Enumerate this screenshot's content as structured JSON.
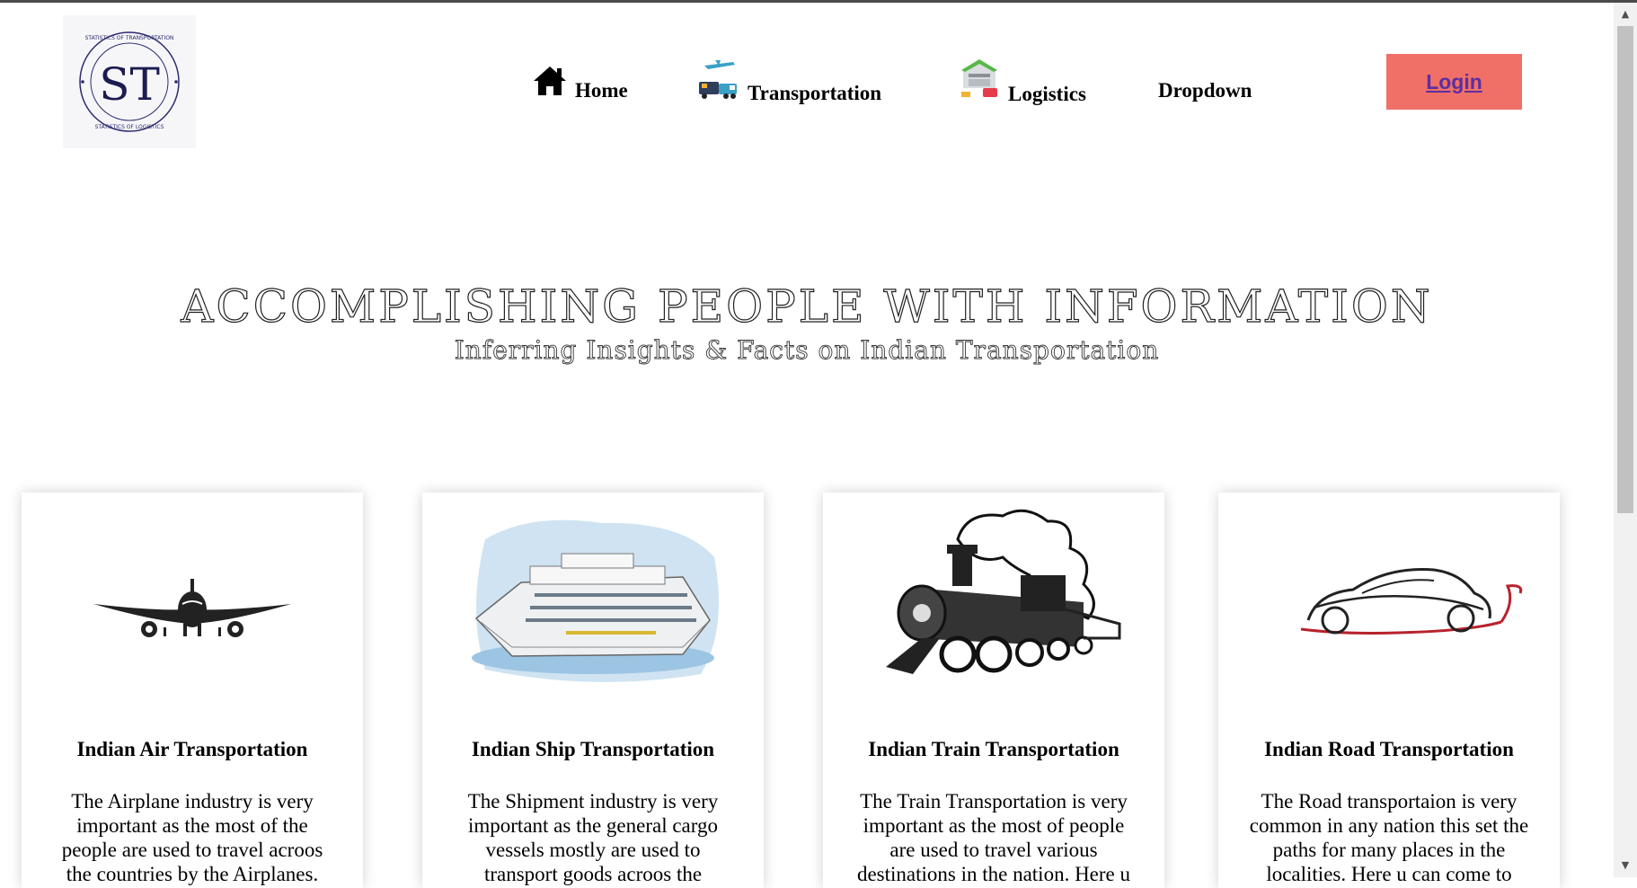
{
  "header": {
    "logo": {
      "letters": "ST",
      "ring_text_top": "STATISTICS OF TRANSPORTATION",
      "ring_text_bottom": "STATISTICS OF LOGISTICS",
      "icon": "st-logo"
    },
    "nav": [
      {
        "label": "Home",
        "icon": "home-icon"
      },
      {
        "label": "Transportation",
        "icon": "transport-icon"
      },
      {
        "label": "Logistics",
        "icon": "warehouse-icon"
      },
      {
        "label": "Dropdown"
      }
    ],
    "login_label": "Login"
  },
  "hero": {
    "title": "ACCOMPLISHING PEOPLE WITH INFORMATION",
    "subtitle": "Inferring Insights & Facts on Indian Transportation"
  },
  "cards": [
    {
      "title": "Indian Air Transportation",
      "text": "The Airplane industry is very important as the most of the people are used to travel acroos the countries by the Airplanes.",
      "icon": "airplane-icon"
    },
    {
      "title": "Indian Ship Transportation",
      "text": "The Shipment industry is very important as the general cargo vessels mostly are used to transport goods acroos the",
      "icon": "cruise-ship-icon"
    },
    {
      "title": "Indian Train Transportation",
      "text": "The Train Transportation is very important as the most of people are used to travel various destinations in the nation. Here u",
      "icon": "steam-train-icon"
    },
    {
      "title": "Indian Road Transportation",
      "text": "The Road transportaion is very common in any nation this set the paths for many places in the localities. Here u can come to",
      "icon": "sports-car-icon"
    }
  ],
  "colors": {
    "login_bg": "#f07068",
    "login_text": "#5b2fa0",
    "logo_ink": "#2a2a6e"
  }
}
